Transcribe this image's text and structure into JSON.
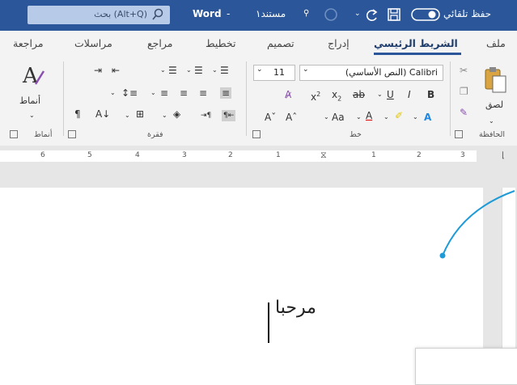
{
  "titlebar": {
    "autosave_label": "حفظ تلقائي",
    "doc_title": "مستند١",
    "app_sep": "-",
    "app_name": "Word",
    "search_placeholder": "بحث (Alt+Q)"
  },
  "tabs": [
    {
      "label": "ملف"
    },
    {
      "label": "الشريط الرئيسي",
      "active": true
    },
    {
      "label": "إدراج"
    },
    {
      "label": "تصميم"
    },
    {
      "label": "تخطيط"
    },
    {
      "label": "مراجع"
    },
    {
      "label": "مراسلات"
    },
    {
      "label": "مراجعة"
    }
  ],
  "ribbon": {
    "clipboard": {
      "paste_label": "لصق",
      "group_label": "الحافظة"
    },
    "font": {
      "font_name": "(النص الأساسي) Calibri",
      "font_size": "11",
      "group_label": "خط"
    },
    "paragraph": {
      "group_label": "فقرة"
    },
    "styles": {
      "styles_label": "أنماط",
      "group_label": "أنماط"
    }
  },
  "ruler": {
    "numbers": [
      "3",
      "2",
      "1",
      "1",
      "2",
      "3",
      "4",
      "5",
      "6"
    ]
  },
  "document": {
    "text": "مرحبا"
  },
  "colors": {
    "titlebar": "#2b579a",
    "ribbon": "#f3f3f3",
    "accent": "#1e9bd7"
  }
}
